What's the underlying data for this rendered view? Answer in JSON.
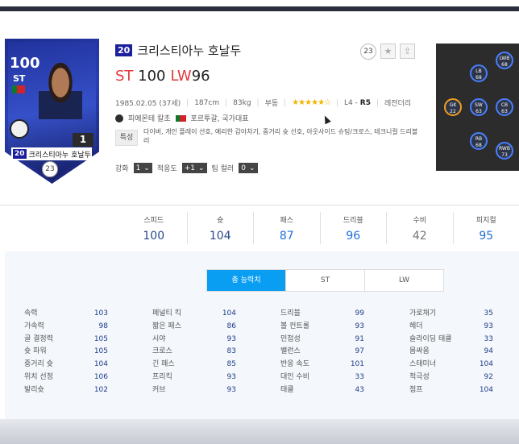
{
  "card": {
    "ovr": "100",
    "position": "ST",
    "level": "1",
    "season": "20",
    "name": "크리스티아누 호날두",
    "circle": "23"
  },
  "player": {
    "season": "20",
    "name": "크리스티아누 호날두",
    "badge_num": "23",
    "primary_pos": "ST",
    "primary_ovr": "100",
    "secondary_pos": "LW",
    "secondary_ovr": "96"
  },
  "meta": {
    "birth": "1985.02.05 (37세)",
    "height": "187cm",
    "weight": "83kg",
    "foot": "부동",
    "stars": "★★★★★☆",
    "level_prefix": "L4 -",
    "level_bold": "R5",
    "grade": "레전더리"
  },
  "team": {
    "club": "피에몬테 칼초",
    "nation": "포르투갈, 국가대표"
  },
  "traits": {
    "label": "특성",
    "text": "다이버, 개인 플레이 선호, 예리한 감아차기, 중거리 슛 선호, 아웃사이드 슈팅/크로스, 테크니컬 드리블러"
  },
  "selectors": {
    "enhance_label": "강화",
    "enhance_value": "1",
    "adapt_label": "적응도",
    "adapt_value": "+1",
    "tip_label": "팀 컬러",
    "tip_value": "0"
  },
  "positions_map": [
    {
      "pos": "LWB",
      "val": "68"
    },
    {
      "pos": "LB",
      "val": "68"
    },
    {
      "pos": "GK",
      "val": "22"
    },
    {
      "pos": "SW",
      "val": "63"
    },
    {
      "pos": "CB",
      "val": "63"
    },
    {
      "pos": "RB",
      "val": "68"
    },
    {
      "pos": "RWB",
      "val": "73"
    }
  ],
  "summary": [
    {
      "label": "스피드",
      "value": "100"
    },
    {
      "label": "슛",
      "value": "104"
    },
    {
      "label": "패스",
      "value": "87"
    },
    {
      "label": "드리블",
      "value": "96"
    },
    {
      "label": "수비",
      "value": "42"
    },
    {
      "label": "피지컬",
      "value": "95"
    }
  ],
  "tabs": [
    "총 능력치",
    "ST",
    "LW"
  ],
  "stats": [
    [
      {
        "name": "속력",
        "value": "103"
      },
      {
        "name": "가속력",
        "value": "98"
      },
      {
        "name": "골 결정력",
        "value": "105"
      },
      {
        "name": "슛 파워",
        "value": "105"
      },
      {
        "name": "중거리 슛",
        "value": "104"
      },
      {
        "name": "위치 선정",
        "value": "106"
      },
      {
        "name": "발리슛",
        "value": "102"
      }
    ],
    [
      {
        "name": "페널티 킥",
        "value": "104"
      },
      {
        "name": "짧은 패스",
        "value": "86"
      },
      {
        "name": "시야",
        "value": "93"
      },
      {
        "name": "크로스",
        "value": "83"
      },
      {
        "name": "긴 패스",
        "value": "85"
      },
      {
        "name": "프리킥",
        "value": "93"
      },
      {
        "name": "커브",
        "value": "93"
      }
    ],
    [
      {
        "name": "드리블",
        "value": "99"
      },
      {
        "name": "볼 컨트롤",
        "value": "93"
      },
      {
        "name": "민첩성",
        "value": "91"
      },
      {
        "name": "밸런스",
        "value": "97"
      },
      {
        "name": "반응 속도",
        "value": "101"
      },
      {
        "name": "대인 수비",
        "value": "33"
      },
      {
        "name": "태클",
        "value": "43"
      }
    ],
    [
      {
        "name": "가로채기",
        "value": "35"
      },
      {
        "name": "헤더",
        "value": "93"
      },
      {
        "name": "슬라이딩 태클",
        "value": "33"
      },
      {
        "name": "몸싸움",
        "value": "94"
      },
      {
        "name": "스태미너",
        "value": "104"
      },
      {
        "name": "적극성",
        "value": "92"
      },
      {
        "name": "점프",
        "value": "104"
      }
    ]
  ]
}
